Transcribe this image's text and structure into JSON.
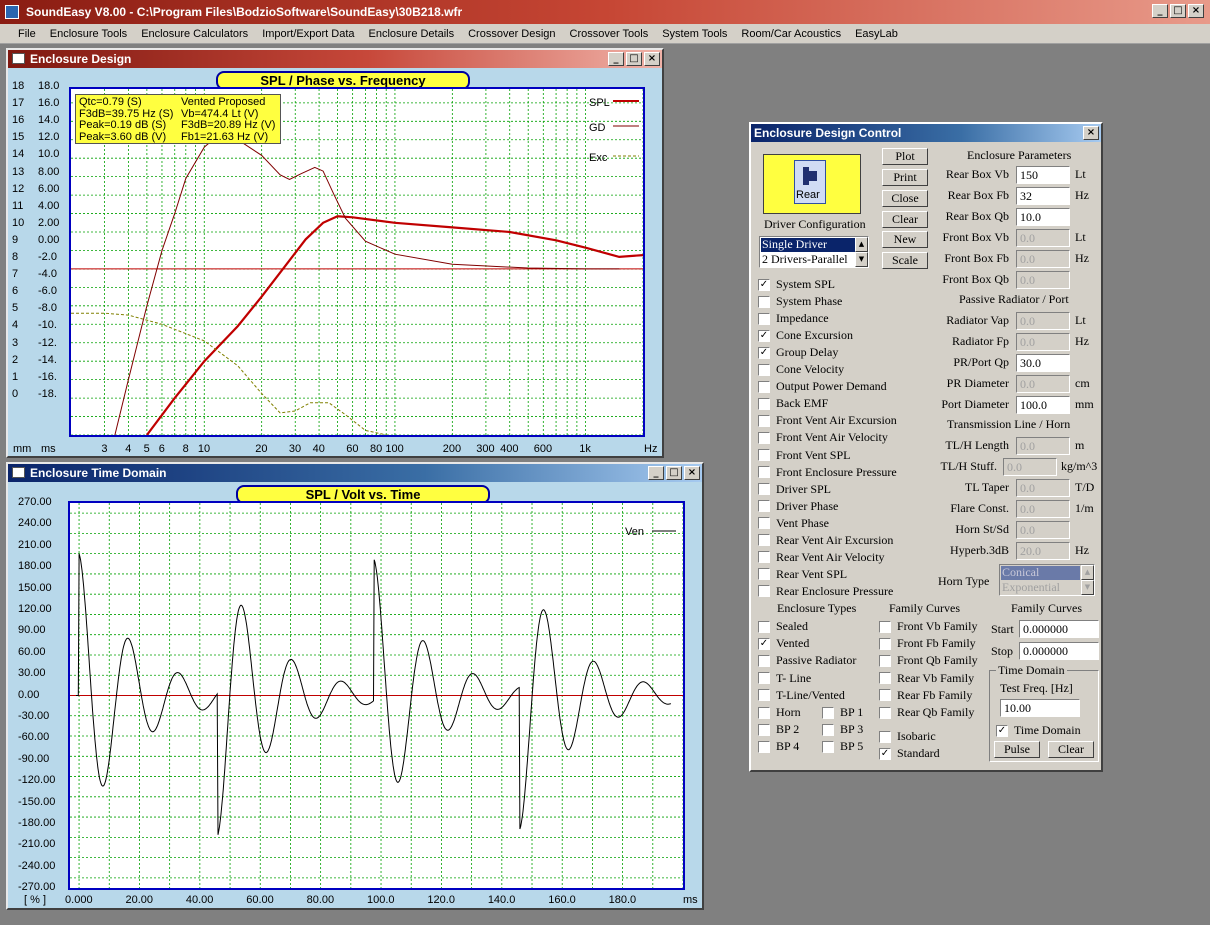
{
  "app": {
    "title": "SoundEasy V8.00 - C:\\Program Files\\BodzioSoftware\\SoundEasy\\30B218.wfr"
  },
  "menu": [
    "File",
    "Enclosure Tools",
    "Enclosure Calculators",
    "Import/Export Data",
    "Enclosure Details",
    "Crossover Design",
    "Crossover Tools",
    "System Tools",
    "Room/Car Acoustics",
    "EasyLab"
  ],
  "enclosure_design": {
    "title": "Enclosure Design",
    "chart_title": "SPL / Phase vs. Frequency",
    "info": {
      "line1a": "Qtc=0.79 (S)",
      "line1b": "Vented Proposed",
      "line2a": "F3dB=39.75 Hz (S)",
      "line2b": "Vb=474.4 Lt (V)",
      "line3a": "Peak=0.19 dB (S)",
      "line3b": "F3dB=20.89 Hz (V)",
      "line4a": "Peak=3.60 dB (V)",
      "line4b": "Fb1=21.63 Hz (V)"
    },
    "legend": [
      "SPL",
      "GD",
      "Exc"
    ],
    "y_left": [
      "18",
      "17",
      "16",
      "15",
      "14",
      "13",
      "12",
      "11",
      "10",
      "9",
      "8",
      "7",
      "6",
      "5",
      "4",
      "3",
      "2",
      "1",
      "0"
    ],
    "y_right": [
      "18.0",
      "16.0",
      "14.0",
      "12.0",
      "10.0",
      "8.00",
      "6.00",
      "4.00",
      "2.00",
      "0.00",
      "-2.0",
      "-4.0",
      "-6.0",
      "-8.0",
      "-10.",
      "-12.",
      "-14.",
      "-16.",
      "-18."
    ],
    "x_ticks": [
      "3",
      "4",
      "5",
      "6",
      "8",
      "10",
      "20",
      "30",
      "40",
      "60",
      "80",
      "100",
      "200",
      "300",
      "400",
      "600",
      "1k"
    ],
    "x_units_left": "mm",
    "x_units_mid": "ms",
    "x_units_right": "Hz"
  },
  "time_domain": {
    "title": "Enclosure Time Domain",
    "chart_title": "SPL / Volt vs. Time",
    "legend": "Ven",
    "y_ticks": [
      "270.00",
      "240.00",
      "210.00",
      "180.00",
      "150.00",
      "120.00",
      "90.00",
      "60.00",
      "30.00",
      "0.00",
      "-30.00",
      "-60.00",
      "-90.00",
      "-120.00",
      "-150.00",
      "-180.00",
      "-210.00",
      "-240.00",
      "-270.00"
    ],
    "x_ticks": [
      "0.000",
      "20.00",
      "40.00",
      "60.00",
      "80.00",
      "100.0",
      "120.0",
      "140.0",
      "160.0",
      "180.0"
    ],
    "x_left": "[ % ]",
    "x_right": "ms"
  },
  "control": {
    "title": "Enclosure Design Control",
    "rear_label": "Rear",
    "driver_config_label": "Driver Configuration",
    "driver_options": [
      "Single Driver",
      "2 Drivers-Parallel"
    ],
    "buttons": [
      "Plot",
      "Print",
      "Close",
      "Clear",
      "New",
      "Scale"
    ],
    "enclosure_params_label": "Enclosure Parameters",
    "params": [
      {
        "label": "Rear Box Vb",
        "value": "150",
        "unit": "Lt",
        "enabled": true
      },
      {
        "label": "Rear Box Fb",
        "value": "32",
        "unit": "Hz",
        "enabled": true
      },
      {
        "label": "Rear Box Qb",
        "value": "10.0",
        "unit": "",
        "enabled": true
      },
      {
        "label": "Front Box Vb",
        "value": "0.0",
        "unit": "Lt",
        "enabled": false
      },
      {
        "label": "Front Box Fb",
        "value": "0.0",
        "unit": "Hz",
        "enabled": false
      },
      {
        "label": "Front Box Qb",
        "value": "0.0",
        "unit": "",
        "enabled": false
      }
    ],
    "passive_label": "Passive Radiator / Port",
    "passive": [
      {
        "label": "Radiator Vap",
        "value": "0.0",
        "unit": "Lt",
        "enabled": false
      },
      {
        "label": "Radiator Fp",
        "value": "0.0",
        "unit": "Hz",
        "enabled": false
      },
      {
        "label": "PR/Port Qp",
        "value": "30.0",
        "unit": "",
        "enabled": true
      },
      {
        "label": "PR Diameter",
        "value": "0.0",
        "unit": "cm",
        "enabled": false
      },
      {
        "label": "Port Diameter",
        "value": "100.0",
        "unit": "mm",
        "enabled": true
      }
    ],
    "tl_label": "Transmission Line / Horn",
    "tl": [
      {
        "label": "TL/H Length",
        "value": "0.0",
        "unit": "m"
      },
      {
        "label": "TL/H Stuff.",
        "value": "0.0",
        "unit": "kg/m^3"
      },
      {
        "label": "TL Taper",
        "value": "0.0",
        "unit": "T/D"
      },
      {
        "label": "Flare Const.",
        "value": "0.0",
        "unit": "1/m"
      },
      {
        "label": "Horn St/Sd",
        "value": "0.0",
        "unit": ""
      },
      {
        "label": "Hyperb.3dB",
        "value": "20.0",
        "unit": "Hz"
      }
    ],
    "horn_type_label": "Horn Type",
    "horn_types": [
      "Conical",
      "Exponential"
    ],
    "checks": [
      {
        "label": "System SPL",
        "checked": true
      },
      {
        "label": "System Phase",
        "checked": false
      },
      {
        "label": "Impedance",
        "checked": false
      },
      {
        "label": "Cone Excursion",
        "checked": true
      },
      {
        "label": "Group Delay",
        "checked": true
      },
      {
        "label": "Cone Velocity",
        "checked": false
      },
      {
        "label": "Output Power Demand",
        "checked": false
      },
      {
        "label": "Back EMF",
        "checked": false
      },
      {
        "label": "Front Vent Air Excursion",
        "checked": false
      },
      {
        "label": "Front Vent Air Velocity",
        "checked": false
      },
      {
        "label": "Front Vent SPL",
        "checked": false
      },
      {
        "label": "Front Enclosure Pressure",
        "checked": false
      },
      {
        "label": "Driver SPL",
        "checked": false
      },
      {
        "label": "Driver Phase",
        "checked": false
      },
      {
        "label": "Vent Phase",
        "checked": false
      },
      {
        "label": "Rear Vent Air Excursion",
        "checked": false
      },
      {
        "label": "Rear Vent Air Velocity",
        "checked": false
      },
      {
        "label": "Rear Vent SPL",
        "checked": false
      },
      {
        "label": "Rear Enclosure Pressure",
        "checked": false
      }
    ],
    "enclosure_types_label": "Enclosure Types",
    "enclosure_types": [
      {
        "label": "Sealed",
        "checked": false
      },
      {
        "label": "Vented",
        "checked": true
      },
      {
        "label": "Passive Radiator",
        "checked": false
      },
      {
        "label": "T- Line",
        "checked": false
      },
      {
        "label": "T-Line/Vented",
        "checked": false
      }
    ],
    "bp_types": [
      {
        "label": "Horn",
        "checked": false
      },
      {
        "label": "BP 1",
        "checked": false
      },
      {
        "label": "BP 2",
        "checked": false
      },
      {
        "label": "BP 3",
        "checked": false
      },
      {
        "label": "BP 4",
        "checked": false
      },
      {
        "label": "BP 5",
        "checked": false
      }
    ],
    "family_label": "Family Curves",
    "family": [
      {
        "label": "Front Vb Family",
        "checked": false
      },
      {
        "label": "Front Fb Family",
        "checked": false
      },
      {
        "label": "Front Qb Family",
        "checked": false
      },
      {
        "label": "Rear Vb Family",
        "checked": false
      },
      {
        "label": "Rear Fb Family",
        "checked": false
      },
      {
        "label": "Rear Qb Family",
        "checked": false
      }
    ],
    "isobaric": {
      "label": "Isobaric",
      "checked": false
    },
    "standard": {
      "label": "Standard",
      "checked": true
    },
    "family_curves2_label": "Family Curves",
    "start_label": "Start",
    "start_value": "0.000000",
    "stop_label": "Stop",
    "stop_value": "0.000000",
    "time_domain_group": "Time Domain",
    "test_freq_label": "Test Freq. [Hz]",
    "test_freq_value": "10.00",
    "time_domain_check": {
      "label": "Time Domain",
      "checked": true
    },
    "pulse_label": "Pulse",
    "clear_label": "Clear"
  },
  "colors": {
    "spl": "#c00000",
    "gd": "#800000",
    "exc": "#808000",
    "grid": "#00a000",
    "plot_border": "#0000c0"
  }
}
